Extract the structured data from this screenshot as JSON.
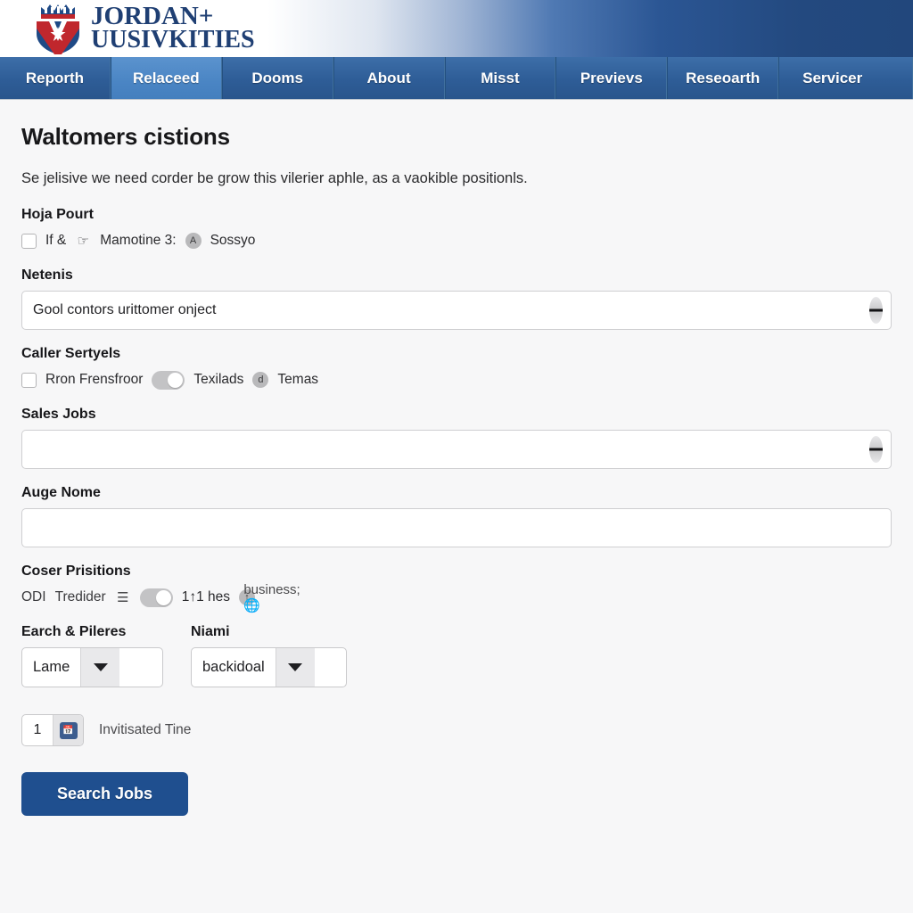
{
  "header": {
    "logo_icon": "shield-crest-icon",
    "brand_line1": "JORDAN+",
    "brand_line2": "UUSIVKITIES"
  },
  "nav": {
    "items": [
      {
        "label": "Reporth",
        "active": false
      },
      {
        "label": "Relaceed",
        "active": true
      },
      {
        "label": "Dooms",
        "active": false
      },
      {
        "label": "About",
        "active": false
      },
      {
        "label": "Misst",
        "active": false
      },
      {
        "label": "Previevs",
        "active": false
      },
      {
        "label": "Reseoarth",
        "active": false
      },
      {
        "label": "Servicer",
        "active": false
      }
    ]
  },
  "main": {
    "title": "Waltomers cistions",
    "description": "Se jelisive we need corder be grow this vilerier aphle, as a vaokible positionls.",
    "sections": {
      "hoja": {
        "label": "Hoja Pourt",
        "checkbox_label": "If &",
        "mid_text": "Mamotine 3:",
        "end_text": "Sossyo",
        "icon_left": "hand-pointer-icon",
        "icon_right": "badge-a-icon"
      },
      "netenis": {
        "label": "Netenis",
        "value": "Gool contors urittomer onject",
        "placeholder": ""
      },
      "caller": {
        "label": "Caller Sertyels",
        "checkbox_label": "Rron Frensfroor",
        "toggle_label": "Texilads",
        "end_text": "Temas",
        "icon_end": "badge-d-icon"
      },
      "sales": {
        "label": "Sales Jobs",
        "value": "",
        "placeholder": ""
      },
      "auge": {
        "label": "Auge Nome",
        "value": "",
        "placeholder": ""
      },
      "coser": {
        "label": "Coser Prisitions",
        "text1": "ODI",
        "text2": "Tredider",
        "icon1": "striped-circle-icon",
        "text3": "1↑1 hes",
        "icon2": "arrow-up-circle-icon",
        "icon3": "globe-icon"
      }
    },
    "selects": [
      {
        "label": "Earch & Pileres",
        "value": "Lame",
        "icon": "chevron-down-icon"
      },
      {
        "label": "Niami",
        "value": "backidoal",
        "icon": "chevron-down-icon"
      }
    ],
    "stepper": {
      "value": "1",
      "button_icon": "calendar-icon",
      "label": "Invitisated Tine"
    },
    "submit": {
      "label": "Search Jobs",
      "color": "#1f4f8f"
    }
  },
  "colors": {
    "nav_blue": "#2e5d97",
    "nav_active_blue": "#4a85c4",
    "brand_navy": "#1f3f73",
    "crest_red": "#c0272d",
    "page_bg": "#f7f7f8"
  }
}
